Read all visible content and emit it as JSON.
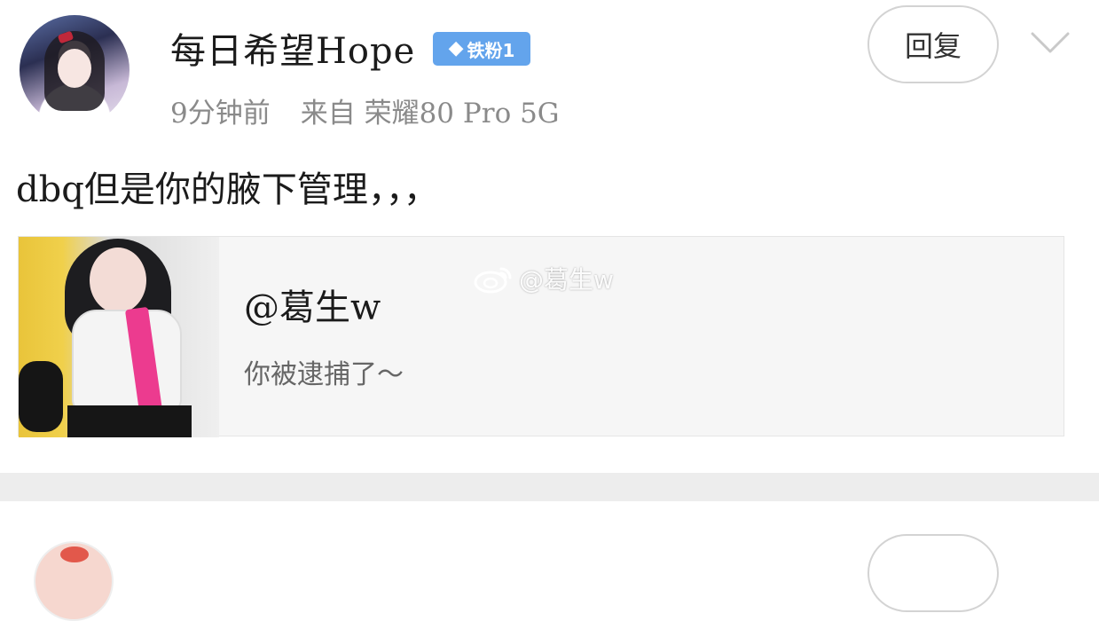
{
  "post": {
    "username": "每日希望Hope",
    "badge": {
      "icon": "diamond-icon",
      "label": "铁粉1",
      "color": "#63a4ec"
    },
    "time": "9分钟前",
    "source": "来自 荣耀80 Pro 5G",
    "reply_label": "回复",
    "text": "dbq但是你的腋下管理，，，"
  },
  "card": {
    "title": "@葛生w",
    "desc": "你被逮捕了～"
  },
  "watermark": {
    "icon": "weibo-logo-icon",
    "text": "@葛生w"
  },
  "colors": {
    "background": "#ffffff",
    "band": "#ededed",
    "badge": "#63a4ec"
  }
}
